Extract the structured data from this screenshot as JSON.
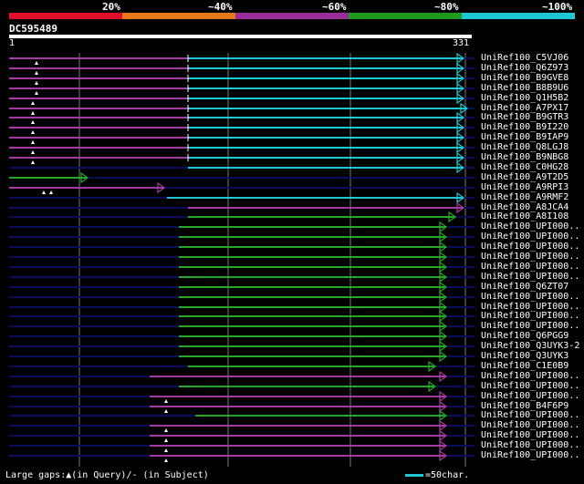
{
  "legend": {
    "labels": [
      "20%",
      "~40%",
      "~60%",
      "~80%",
      "~100%"
    ],
    "colors": [
      "#e0102c",
      "#e8781e",
      "#9a2c9a",
      "#1e9a1e",
      "#1ec8d2"
    ]
  },
  "query": {
    "name": "DC595489",
    "start": "1",
    "end": "331"
  },
  "colors": {
    "cyan": "#1ec8d2",
    "purple": "#a33ba3",
    "green": "#27a627",
    "navy": "#0c0c5a"
  },
  "hits": [
    {
      "label": "UniRef100_C5VJ06",
      "color": "purple",
      "split": 206,
      "end": 508,
      "marks": [
        40
      ]
    },
    {
      "label": "UniRef100_Q6Z973",
      "color": "purple",
      "split": 206,
      "end": 508,
      "marks": [
        40
      ]
    },
    {
      "label": "UniRef100_B9GVE8",
      "color": "purple",
      "split": 206,
      "end": 508,
      "marks": [
        40
      ]
    },
    {
      "label": "UniRef100_B8B9U6",
      "color": "purple",
      "split": 206,
      "end": 508,
      "marks": [
        40
      ]
    },
    {
      "label": "UniRef100_Q1H5B2",
      "color": "purple",
      "split": 206,
      "end": 508,
      "marks": [
        36
      ]
    },
    {
      "label": "UniRef100_A7PX17",
      "color": "purple",
      "split": 206,
      "end": 512,
      "marks": [
        36
      ]
    },
    {
      "label": "UniRef100_B9GTR3",
      "color": "purple",
      "split": 206,
      "end": 508,
      "marks": [
        36
      ]
    },
    {
      "label": "UniRef100_B9I220",
      "color": "purple",
      "split": 206,
      "end": 508,
      "marks": [
        36
      ]
    },
    {
      "label": "UniRef100_B9IAP9",
      "color": "purple",
      "split": 206,
      "end": 508,
      "marks": [
        36
      ]
    },
    {
      "label": "UniRef100_Q8LGJ8",
      "color": "purple",
      "split": 206,
      "end": 508,
      "marks": [
        36
      ]
    },
    {
      "label": "UniRef100_B9NBG8",
      "color": "purple",
      "split": 206,
      "end": 508,
      "marks": [
        36
      ]
    },
    {
      "label": "UniRef100_C0HG28",
      "color": "cyan",
      "start": 206,
      "end": 508,
      "marks": []
    },
    {
      "label": "UniRef100_A9T2D5",
      "color": "green",
      "start": 10,
      "end": 96,
      "marks": []
    },
    {
      "label": "UniRef100_A9RPI3",
      "color": "purple",
      "start": 10,
      "end": 180,
      "marks": [
        48,
        56
      ]
    },
    {
      "label": "UniRef100_A9RMF2",
      "color": "cyan",
      "start": 183,
      "end": 508,
      "marks": []
    },
    {
      "label": "UniRef100_A8JCA4",
      "color": "purple",
      "start": 206,
      "end": 508,
      "marks": []
    },
    {
      "label": "UniRef100_A8I108",
      "color": "green",
      "start": 206,
      "end": 499,
      "marks": []
    },
    {
      "label": "UniRef100_UPI000..",
      "color": "green",
      "start": 196,
      "end": 489,
      "marks": []
    },
    {
      "label": "UniRef100_UPI000..",
      "color": "green",
      "start": 196,
      "end": 489,
      "marks": []
    },
    {
      "label": "UniRef100_UPI000..",
      "color": "green",
      "start": 196,
      "end": 489,
      "marks": []
    },
    {
      "label": "UniRef100_UPI000..",
      "color": "green",
      "start": 196,
      "end": 489,
      "marks": []
    },
    {
      "label": "UniRef100_UPI000..",
      "color": "green",
      "start": 196,
      "end": 489,
      "marks": []
    },
    {
      "label": "UniRef100_UPI000..",
      "color": "green",
      "start": 196,
      "end": 489,
      "marks": []
    },
    {
      "label": "UniRef100_Q6ZT07",
      "color": "green",
      "start": 196,
      "end": 489,
      "marks": []
    },
    {
      "label": "UniRef100_UPI000..",
      "color": "green",
      "start": 196,
      "end": 489,
      "marks": []
    },
    {
      "label": "UniRef100_UPI000..",
      "color": "green",
      "start": 196,
      "end": 489,
      "marks": []
    },
    {
      "label": "UniRef100_UPI000..",
      "color": "green",
      "start": 196,
      "end": 489,
      "marks": []
    },
    {
      "label": "UniRef100_UPI000..",
      "color": "green",
      "start": 196,
      "end": 489,
      "marks": []
    },
    {
      "label": "UniRef100_Q6PGG9",
      "color": "green",
      "start": 196,
      "end": 489,
      "marks": []
    },
    {
      "label": "UniRef100_Q3UYK3-2",
      "color": "green",
      "start": 196,
      "end": 489,
      "marks": []
    },
    {
      "label": "UniRef100_Q3UYK3",
      "color": "green",
      "start": 196,
      "end": 489,
      "marks": []
    },
    {
      "label": "UniRef100_C1E0B9",
      "color": "green",
      "start": 206,
      "end": 477,
      "marks": []
    },
    {
      "label": "UniRef100_UPI000..",
      "color": "purple",
      "start": 164,
      "end": 489,
      "marks": []
    },
    {
      "label": "UniRef100_UPI000..",
      "color": "green",
      "start": 196,
      "end": 477,
      "marks": []
    },
    {
      "label": "UniRef100_UPI000..",
      "color": "purple",
      "start": 164,
      "end": 489,
      "marks": [
        182
      ]
    },
    {
      "label": "UniRef100_B4F6P9",
      "color": "purple",
      "start": 164,
      "end": 489,
      "marks": [
        182
      ]
    },
    {
      "label": "UniRef100_UPI000..",
      "color": "green",
      "start": 214,
      "end": 489,
      "marks": []
    },
    {
      "label": "UniRef100_UPI000..",
      "color": "purple",
      "start": 164,
      "end": 489,
      "marks": [
        182
      ]
    },
    {
      "label": "UniRef100_UPI000..",
      "color": "purple",
      "start": 164,
      "end": 489,
      "marks": [
        182
      ]
    },
    {
      "label": "UniRef100_UPI000..",
      "color": "purple",
      "start": 164,
      "end": 489,
      "marks": [
        182
      ]
    },
    {
      "label": "UniRef100_UPI000..",
      "color": "purple",
      "start": 164,
      "end": 489,
      "marks": [
        182
      ]
    }
  ],
  "footer": {
    "gaps": "Large gaps:▲(in Query)/- (in Subject)",
    "scale": "=50char."
  }
}
